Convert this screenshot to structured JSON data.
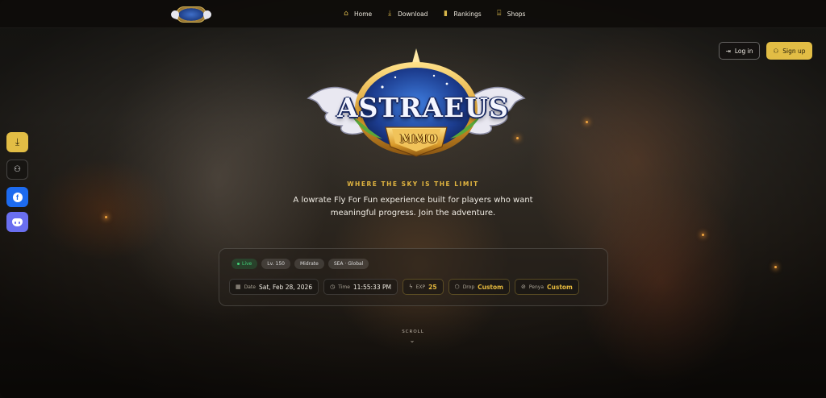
{
  "nav": {
    "logo_alt": "Astraeus MMO",
    "items": [
      {
        "label": "Home",
        "icon": "home-icon"
      },
      {
        "label": "Download",
        "icon": "download-icon"
      },
      {
        "label": "Rankings",
        "icon": "bar-chart-icon"
      },
      {
        "label": "Shops",
        "icon": "shop-icon"
      }
    ]
  },
  "auth": {
    "login": "Log in",
    "signup": "Sign up"
  },
  "side": [
    {
      "name": "download",
      "icon": "download-icon"
    },
    {
      "name": "register",
      "icon": "user-plus-icon"
    },
    {
      "name": "facebook",
      "icon": "facebook-icon"
    },
    {
      "name": "discord",
      "icon": "discord-icon"
    }
  ],
  "hero": {
    "logo_word": "ASTRAEUS",
    "logo_sub": "MMO",
    "tagline": "WHERE THE SKY IS THE LIMIT",
    "description": "A lowrate Fly For Fun experience built for players who want meaningful progress. Join the adventure."
  },
  "status": {
    "chips": [
      "Live",
      "Lv. 150",
      "Midrate",
      "SEA · Global"
    ],
    "date_label": "Date",
    "date_value": "Sat, Feb 28, 2026",
    "time_label": "Time",
    "time_value": "11:55:33 PM",
    "exp_label": "EXP",
    "exp_value": "25",
    "drop_label": "Drop",
    "drop_value": "Custom",
    "penya_label": "Penya",
    "penya_value": "Custom"
  },
  "scroll": {
    "label": "SCROLL"
  },
  "colors": {
    "accent": "#e2bd45",
    "live": "#43d57a",
    "facebook": "#1d6bef",
    "discord": "#6a6ff0"
  }
}
